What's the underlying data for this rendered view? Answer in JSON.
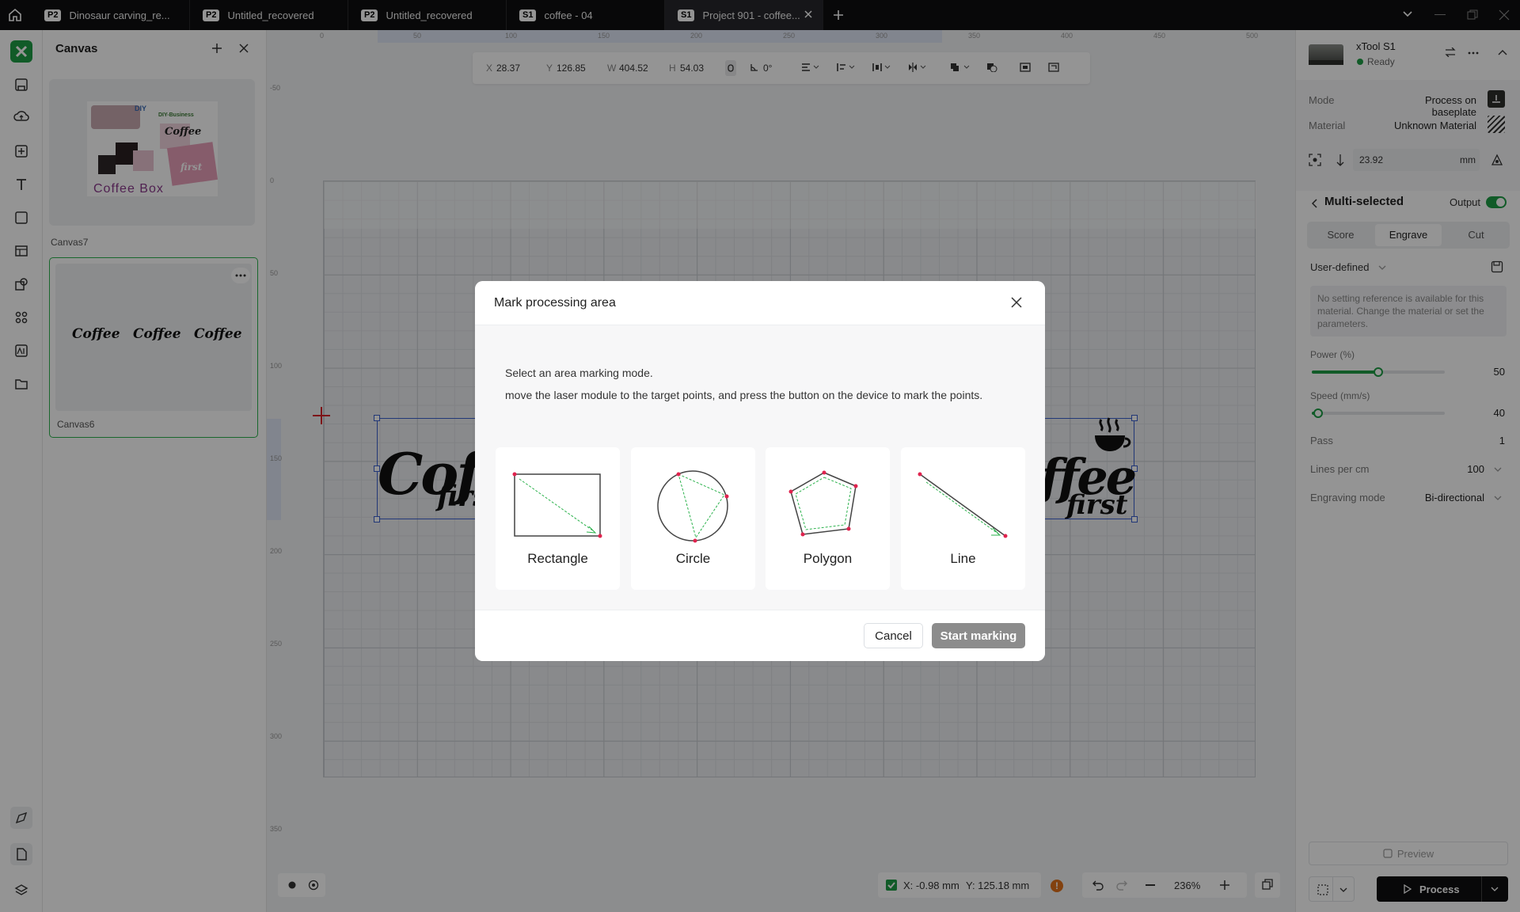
{
  "tabs": [
    {
      "badge": "P2",
      "label": "Dinosaur carving_re..."
    },
    {
      "badge": "P2",
      "label": "Untitled_recovered"
    },
    {
      "badge": "P2",
      "label": "Untitled_recovered"
    },
    {
      "badge": "S1",
      "label": "coffee - 04"
    },
    {
      "badge": "S1",
      "label": "Project 901 - coffee..."
    }
  ],
  "panel": {
    "title": "Canvas",
    "canvases": [
      {
        "name": "Canvas7",
        "thumb_text": "Coffee Box"
      },
      {
        "name": "Canvas6"
      }
    ],
    "thumb7": {
      "diy": "DIY",
      "brand": "DIY-Business",
      "coffee": "Coffee",
      "first": "first"
    }
  },
  "toolbar": {
    "x_label": "X",
    "x": "28.37",
    "y_label": "Y",
    "y": "126.85",
    "w_label": "W",
    "w": "404.52",
    "h_label": "H",
    "h": "54.03",
    "rotation": "0°"
  },
  "ruler": {
    "top": [
      "0",
      "50",
      "100",
      "150",
      "200",
      "250",
      "300",
      "350",
      "400",
      "450",
      "500"
    ],
    "left": [
      "-50",
      "0",
      "50",
      "100",
      "150",
      "200",
      "250",
      "300",
      "350"
    ]
  },
  "canvas_art": {
    "coffee": "Coffee",
    "first": "first",
    "ffee": "ffee"
  },
  "device": {
    "name": "xTool S1",
    "status": "Ready"
  },
  "settings": {
    "mode_label": "Mode",
    "mode_value": "Process on baseplate",
    "material_label": "Material",
    "material_value": "Unknown Material",
    "thickness": "23.92",
    "thickness_unit": "mm",
    "section_title": "Multi-selected",
    "output_label": "Output",
    "tabs": [
      "Score",
      "Engrave",
      "Cut"
    ],
    "preset": "User-defined",
    "notice": "No setting reference is available for this material. Change the material or set the parameters.",
    "power_label": "Power (%)",
    "power_value": "50",
    "power_fraction": 0.5,
    "speed_label": "Speed (mm/s)",
    "speed_value": "40",
    "speed_fraction": 0.05,
    "pass_label": "Pass",
    "pass_value": "1",
    "lpc_label": "Lines per cm",
    "lpc_value": "100",
    "engrave_mode_label": "Engraving mode",
    "engrave_mode_value": "Bi-directional"
  },
  "footer": {
    "preview": "Preview",
    "process": "Process"
  },
  "status": {
    "x": "X: -0.98 mm",
    "y": "Y: 125.18 mm",
    "zoom": "236%"
  },
  "dialog": {
    "title": "Mark processing area",
    "line1": "Select an area marking mode.",
    "line2": "move the laser module to the target points, and press the button on the device to mark the points.",
    "modes": [
      {
        "label": "Rectangle"
      },
      {
        "label": "Circle"
      },
      {
        "label": "Polygon"
      },
      {
        "label": "Line"
      }
    ],
    "cancel": "Cancel",
    "start": "Start marking"
  },
  "colors": {
    "accent": "#1e9e45",
    "point": "#e0234e",
    "guide": "#2bb24c"
  }
}
